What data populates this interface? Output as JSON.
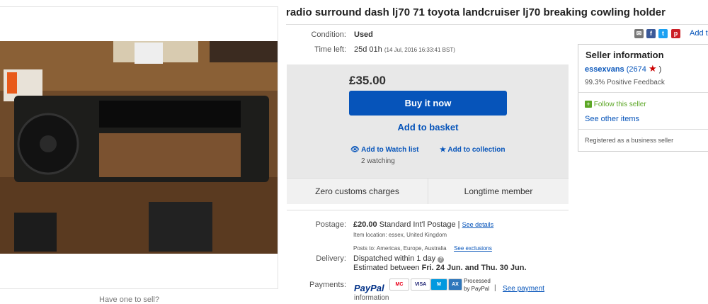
{
  "title": "radio surround dash lj70 71 toyota landcruiser lj70 breaking cowling holder",
  "share": {
    "add_to": "Add to"
  },
  "condition": {
    "label": "Condition:",
    "value": "Used"
  },
  "time_left": {
    "label": "Time left:",
    "value": "25d 01h",
    "detail": "(14 Jul, 2016   16:33:41 BST)"
  },
  "buy_box": {
    "price": "£35.00",
    "buy_now": "Buy it now",
    "add_to_basket": "Add to basket",
    "add_to_watch": "Add to Watch list",
    "watching": "2 watching",
    "add_to_collection": "Add to collection"
  },
  "tiles": {
    "customs": "Zero customs charges",
    "longtime": "Longtime member"
  },
  "seller": {
    "heading": "Seller information",
    "name": "essexvans",
    "feedback_open": "(2674",
    "feedback_close": ")",
    "positive": "99.3% Positive Feedback",
    "follow": "Follow this seller",
    "see_other": "See other items",
    "registered": "Registered as a business seller"
  },
  "postage": {
    "label": "Postage:",
    "amount": "£20.00",
    "method": "Standard Int'l Postage |",
    "see_details": "See details",
    "item_location": "Item location:  essex, United Kingdom",
    "posts_to": "Posts to:  Americas, Europe, Australia",
    "see_exclusions": "See exclusions"
  },
  "delivery": {
    "label": "Delivery:",
    "dispatched": "Dispatched within 1 day",
    "estimated_prefix": "Estimated between",
    "estimated_range": "Fri. 24 Jun. and Thu. 30 Jun."
  },
  "payments": {
    "label": "Payments:",
    "paypal": "PayPal",
    "processed": "Processed",
    "by_paypal": "by PayPal",
    "separator": "|",
    "see_payment": "See payment",
    "information": "information",
    "cards": [
      "MasterCard",
      "VISA",
      "Maestro",
      "AMEX"
    ]
  },
  "bottom_note": "Have one to sell?",
  "colors": {
    "link": "#0654ba",
    "button": "#0654ba",
    "buybox_bg": "#e8e8e8",
    "star": "#cc0000"
  }
}
